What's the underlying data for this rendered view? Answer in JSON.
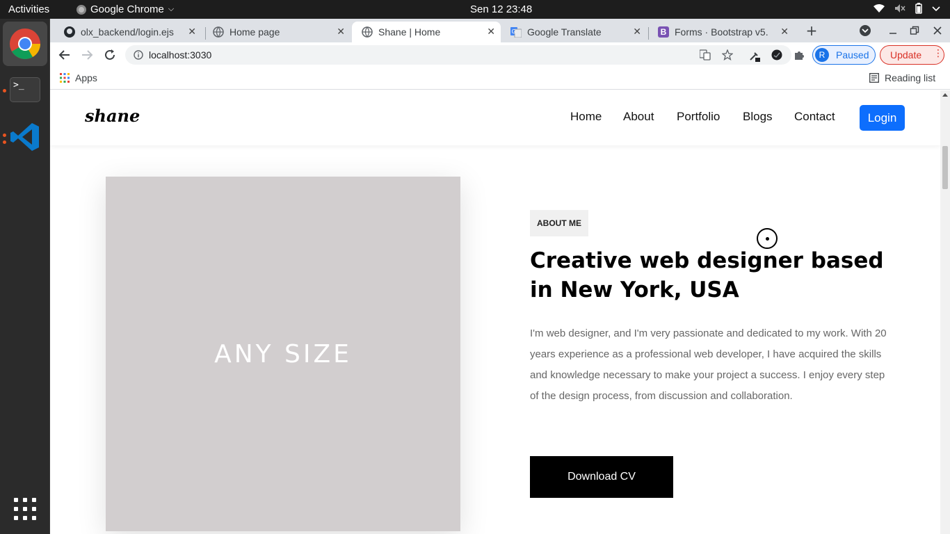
{
  "system_bar": {
    "activities": "Activities",
    "app_name": "Google Chrome",
    "clock": "Sen 12  23:48"
  },
  "browser": {
    "tabs": [
      {
        "title": "olx_backend/login.ejs",
        "icon": "github-icon"
      },
      {
        "title": "Home page",
        "icon": "globe-icon"
      },
      {
        "title": "Shane | Home",
        "icon": "globe-icon",
        "active": true
      },
      {
        "title": "Google Translate",
        "icon": "translate-icon"
      },
      {
        "title": "Forms · Bootstrap v5.",
        "icon": "bootstrap-icon"
      }
    ],
    "url": "localhost:3030",
    "profile_initial": "R",
    "profile_status": "Paused",
    "update_label": "Update",
    "apps_label": "Apps",
    "reading_list_label": "Reading list"
  },
  "site": {
    "brand": "shane",
    "nav": [
      "Home",
      "About",
      "Portfolio",
      "Blogs",
      "Contact"
    ],
    "login_label": "Login",
    "photo_placeholder": "ANY SIZE",
    "badge": "ABOUT ME",
    "headline": "Creative web designer based in New York, USA",
    "bio": "I'm web designer, and I'm very passionate and dedicated to my work. With 20 years experience as a professional web developer, I have acquired the skills and knowledge necessary to make your project a success. I enjoy every step of the design process, from discussion and collaboration.",
    "download_label": "Download CV"
  },
  "colors": {
    "primary": "#0d6efd",
    "update_red": "#d93025",
    "profile_blue": "#1a73e8"
  }
}
